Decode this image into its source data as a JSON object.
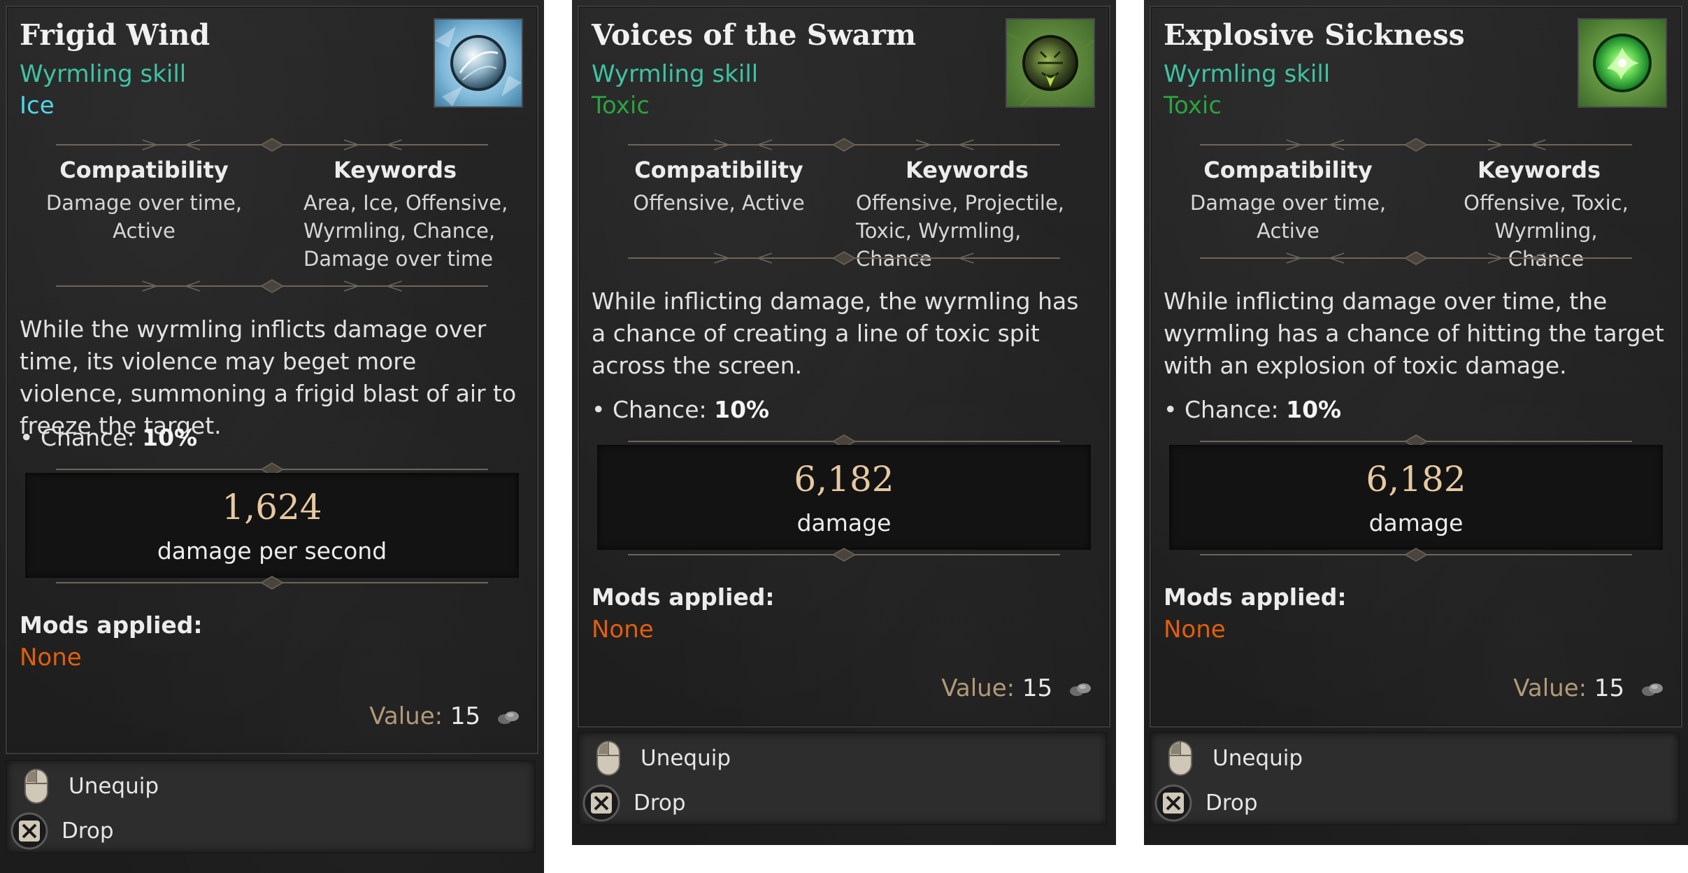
{
  "cards": [
    {
      "title": "Frigid Wind",
      "subtitle": "Wyrmling skill",
      "element": "Ice",
      "element_color": "#4fd6e8",
      "icon": "frigid-wind-icon",
      "compatibility_label": "Compatibility",
      "compatibility": "Damage over time, Active",
      "keywords_label": "Keywords",
      "keywords": "Area, Ice, Offensive,\nWyrmling, Chance,\nDamage over time",
      "description": "While the wyrmling inflicts damage over time, its violence may beget more violence, summoning a frigid blast of air to freeze the target.",
      "stat_label": "• Chance: ",
      "stat_value": "10%",
      "damage_value": "1,624",
      "damage_label": "damage per second",
      "mods_label": "Mods applied:",
      "mods_value": "None",
      "value_label": "Value:",
      "value": "15",
      "unequip_label": "Unequip",
      "drop_label": "Drop"
    },
    {
      "title": "Voices of the Swarm",
      "subtitle": "Wyrmling skill",
      "element": "Toxic",
      "element_color": "#2aa33f",
      "icon": "voices-of-the-swarm-icon",
      "compatibility_label": "Compatibility",
      "compatibility": "Offensive, Active",
      "keywords_label": "Keywords",
      "keywords": "Offensive, Projectile,\nToxic, Wyrmling, Chance",
      "description": "While inflicting damage, the wyrmling has a chance of creating a line of toxic spit across the screen.",
      "stat_label": "• Chance: ",
      "stat_value": "10%",
      "damage_value": "6,182",
      "damage_label": "damage",
      "mods_label": "Mods applied:",
      "mods_value": "None",
      "value_label": "Value:",
      "value": "15",
      "unequip_label": "Unequip",
      "drop_label": "Drop"
    },
    {
      "title": "Explosive Sickness",
      "subtitle": "Wyrmling skill",
      "element": "Toxic",
      "element_color": "#2aa33f",
      "icon": "explosive-sickness-icon",
      "compatibility_label": "Compatibility",
      "compatibility": "Damage over time, Active",
      "keywords_label": "Keywords",
      "keywords": "Offensive, Toxic, Wyrmling,\nChance",
      "description": "While inflicting damage over time, the wyrmling has a chance of hitting the target with an explosion of toxic damage.",
      "stat_label": "• Chance: ",
      "stat_value": "10%",
      "damage_value": "6,182",
      "damage_label": "damage",
      "mods_label": "Mods applied:",
      "mods_value": "None",
      "value_label": "Value:",
      "value": "15",
      "unequip_label": "Unequip",
      "drop_label": "Drop"
    }
  ]
}
